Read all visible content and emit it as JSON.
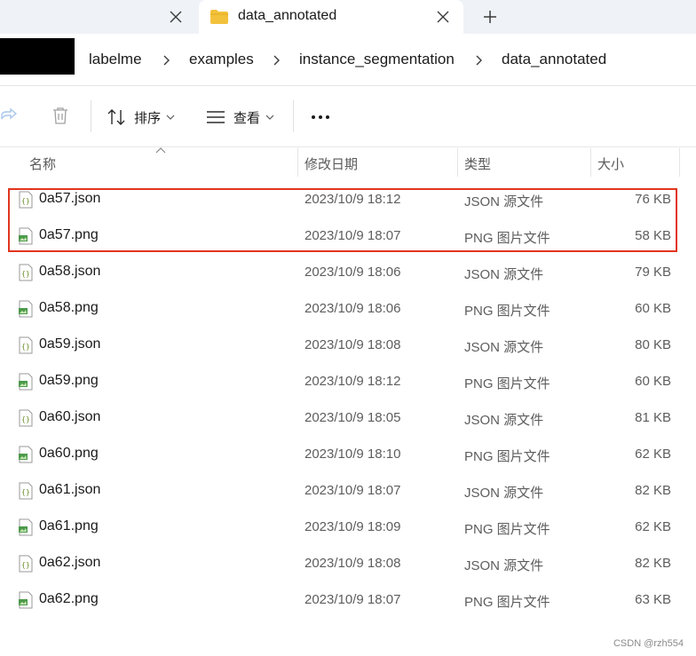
{
  "tabs": [
    {
      "label": "",
      "active": false
    },
    {
      "label": "data_annotated",
      "active": true
    }
  ],
  "breadcrumb": [
    "labelme",
    "examples",
    "instance_segmentation",
    "data_annotated"
  ],
  "toolbar": {
    "sort_label": "排序",
    "view_label": "查看",
    "more_label": "···"
  },
  "columns": {
    "name": "名称",
    "date": "修改日期",
    "type": "类型",
    "size": "大小"
  },
  "files": [
    {
      "name": "0a57.json",
      "date": "2023/10/9 18:12",
      "type": "JSON 源文件",
      "size": "76 KB",
      "icon": "json-file-icon"
    },
    {
      "name": "0a57.png",
      "date": "2023/10/9 18:07",
      "type": "PNG 图片文件",
      "size": "58 KB",
      "icon": "png-file-icon"
    },
    {
      "name": "0a58.json",
      "date": "2023/10/9 18:06",
      "type": "JSON 源文件",
      "size": "79 KB",
      "icon": "json-file-icon"
    },
    {
      "name": "0a58.png",
      "date": "2023/10/9 18:06",
      "type": "PNG 图片文件",
      "size": "60 KB",
      "icon": "png-file-icon"
    },
    {
      "name": "0a59.json",
      "date": "2023/10/9 18:08",
      "type": "JSON 源文件",
      "size": "80 KB",
      "icon": "json-file-icon"
    },
    {
      "name": "0a59.png",
      "date": "2023/10/9 18:12",
      "type": "PNG 图片文件",
      "size": "60 KB",
      "icon": "png-file-icon"
    },
    {
      "name": "0a60.json",
      "date": "2023/10/9 18:05",
      "type": "JSON 源文件",
      "size": "81 KB",
      "icon": "json-file-icon"
    },
    {
      "name": "0a60.png",
      "date": "2023/10/9 18:10",
      "type": "PNG 图片文件",
      "size": "62 KB",
      "icon": "png-file-icon"
    },
    {
      "name": "0a61.json",
      "date": "2023/10/9 18:07",
      "type": "JSON 源文件",
      "size": "82 KB",
      "icon": "json-file-icon"
    },
    {
      "name": "0a61.png",
      "date": "2023/10/9 18:09",
      "type": "PNG 图片文件",
      "size": "62 KB",
      "icon": "png-file-icon"
    },
    {
      "name": "0a62.json",
      "date": "2023/10/9 18:08",
      "type": "JSON 源文件",
      "size": "82 KB",
      "icon": "json-file-icon"
    },
    {
      "name": "0a62.png",
      "date": "2023/10/9 18:07",
      "type": "PNG 图片文件",
      "size": "63 KB",
      "icon": "png-file-icon"
    }
  ],
  "watermark": "CSDN @rzh554",
  "colors": {
    "highlight": "#e2351f",
    "folder": "#f3c23c"
  }
}
